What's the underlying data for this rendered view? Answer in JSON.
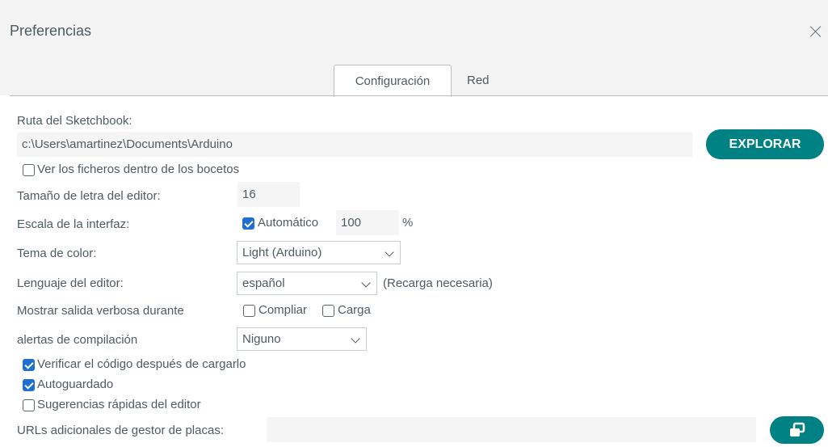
{
  "window": {
    "title": "Preferencias"
  },
  "tabs": [
    {
      "label": "Configuración",
      "active": true
    },
    {
      "label": "Red",
      "active": false
    }
  ],
  "sketchbook": {
    "label": "Ruta del Sketchbook:",
    "value": "c:\\Users\\amartinez\\Documents\\Arduino",
    "browse_label": "EXPLORAR",
    "show_files_label": "Ver los ficheros dentro de los bocetos",
    "show_files_checked": false
  },
  "font_size": {
    "label": "Tamaño de letra del editor:",
    "value": "16"
  },
  "scale": {
    "label": "Escala de la interfaz:",
    "auto_label": "Automático",
    "auto_checked": true,
    "value": "100",
    "unit": "%"
  },
  "theme": {
    "label": "Tema de color:",
    "selected": "Light (Arduino)"
  },
  "language": {
    "label": "Lenguaje del editor:",
    "selected": "español",
    "note": "(Recarga necesaria)"
  },
  "verbose": {
    "label": "Mostrar salida verbosa durante",
    "compile_label": "Compliar",
    "compile_checked": false,
    "upload_label": "Carga",
    "upload_checked": false
  },
  "warnings": {
    "label": "alertas de compilación",
    "selected": "Niguno"
  },
  "options": [
    {
      "label": "Verificar el código después de cargarlo",
      "checked": true
    },
    {
      "label": "Autoguardado",
      "checked": true
    },
    {
      "label": "Sugerencias rápidas del editor",
      "checked": false
    }
  ],
  "board_urls": {
    "label": "URLs adicionales de gestor de placas:",
    "value": ""
  },
  "colors": {
    "accent": "#008184",
    "checkbox_on": "#1f6fd0",
    "text": "#4e5b61"
  }
}
